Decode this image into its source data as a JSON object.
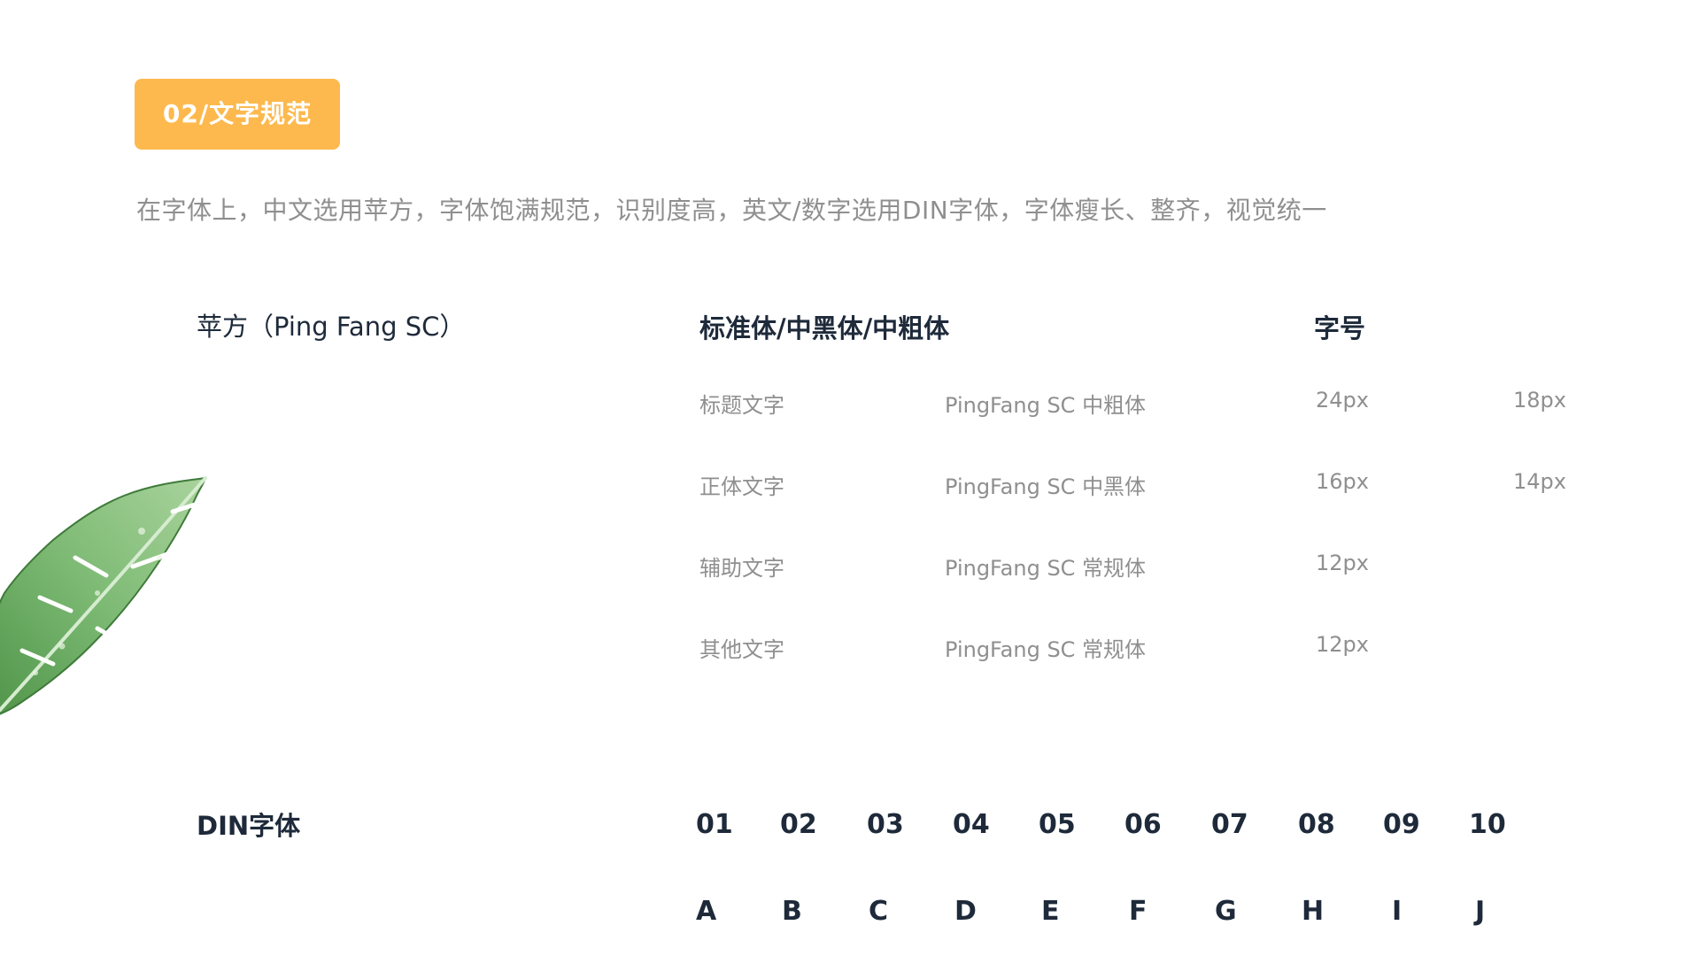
{
  "section": {
    "badge_label": "02/文字规范"
  },
  "intro_text": "在字体上，中文选用苹方，字体饱满规范，识别度高，英文/数字选用DIN字体，字体瘦长、整齐，视觉统一",
  "headings": {
    "pingfang": "苹方（Ping Fang SC）",
    "weights": "标准体/中黑体/中粗体",
    "size": "字号",
    "din": "DIN字体"
  },
  "spec_rows": [
    {
      "name": "标题文字",
      "font": "PingFang SC 中粗体",
      "size_1": "24px",
      "size_2": "18px"
    },
    {
      "name": "正体文字",
      "font": "PingFang SC 中黑体",
      "size_1": "16px",
      "size_2": "14px"
    },
    {
      "name": "辅助文字",
      "font": "PingFang SC 常规体",
      "size_1": "12px",
      "size_2": ""
    },
    {
      "name": "其他文字",
      "font": "PingFang SC 常规体",
      "size_1": "12px",
      "size_2": ""
    }
  ],
  "din_numbers": [
    "01",
    "02",
    "03",
    "04",
    "05",
    "06",
    "07",
    "08",
    "09",
    "10"
  ],
  "din_letters": [
    "A",
    "B",
    "C",
    "D",
    "E",
    "F",
    "G",
    "H",
    "I",
    "J"
  ],
  "decoration": {
    "leaf_icon": "banana-leaf-icon",
    "leaf_color": "#6aa862"
  },
  "colors": {
    "badge": "#fdb94e",
    "heading": "#1e2a3a",
    "muted": "#8f8f8f"
  }
}
